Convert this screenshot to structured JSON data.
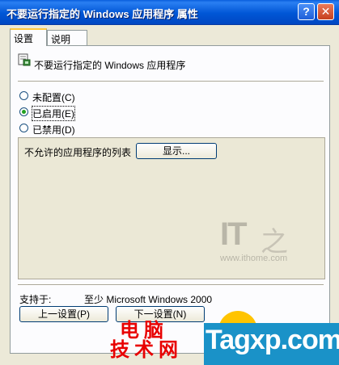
{
  "window": {
    "title": "不要运行指定的 Windows 应用程序 属性",
    "help_glyph": "?",
    "close_glyph": "✕"
  },
  "tabs": [
    {
      "label": "设置",
      "active": true
    },
    {
      "label": "说明",
      "active": false
    }
  ],
  "policy": {
    "icon": "policy-setting-icon",
    "name": "不要运行指定的 Windows 应用程序"
  },
  "state_options": [
    {
      "label": "未配置(C)",
      "checked": false
    },
    {
      "label": "已启用(E)",
      "checked": true
    },
    {
      "label": "已禁用(D)",
      "checked": false
    }
  ],
  "options": {
    "list_label": "不允许的应用程序的列表",
    "show_button": "显示..."
  },
  "supported": {
    "label": "支持于:",
    "value": "至少 Microsoft Windows 2000"
  },
  "nav": {
    "prev_button": "上一设置(P)",
    "next_button": "下一设置(N)"
  },
  "watermarks": {
    "ithome_logo": "IT之家",
    "ithome_url": "www.ithome.com",
    "cn_line1": "电脑",
    "cn_line2": "技术网",
    "tagxp": "Tagxp.com"
  },
  "colors": {
    "titlebar": "#0054e3",
    "dialog_bg": "#ece9d8",
    "tab_accent": "#ffc83c",
    "radio_dot": "#21a121",
    "watermark_red": "#e80000",
    "watermark_blue": "#1a92c8"
  }
}
